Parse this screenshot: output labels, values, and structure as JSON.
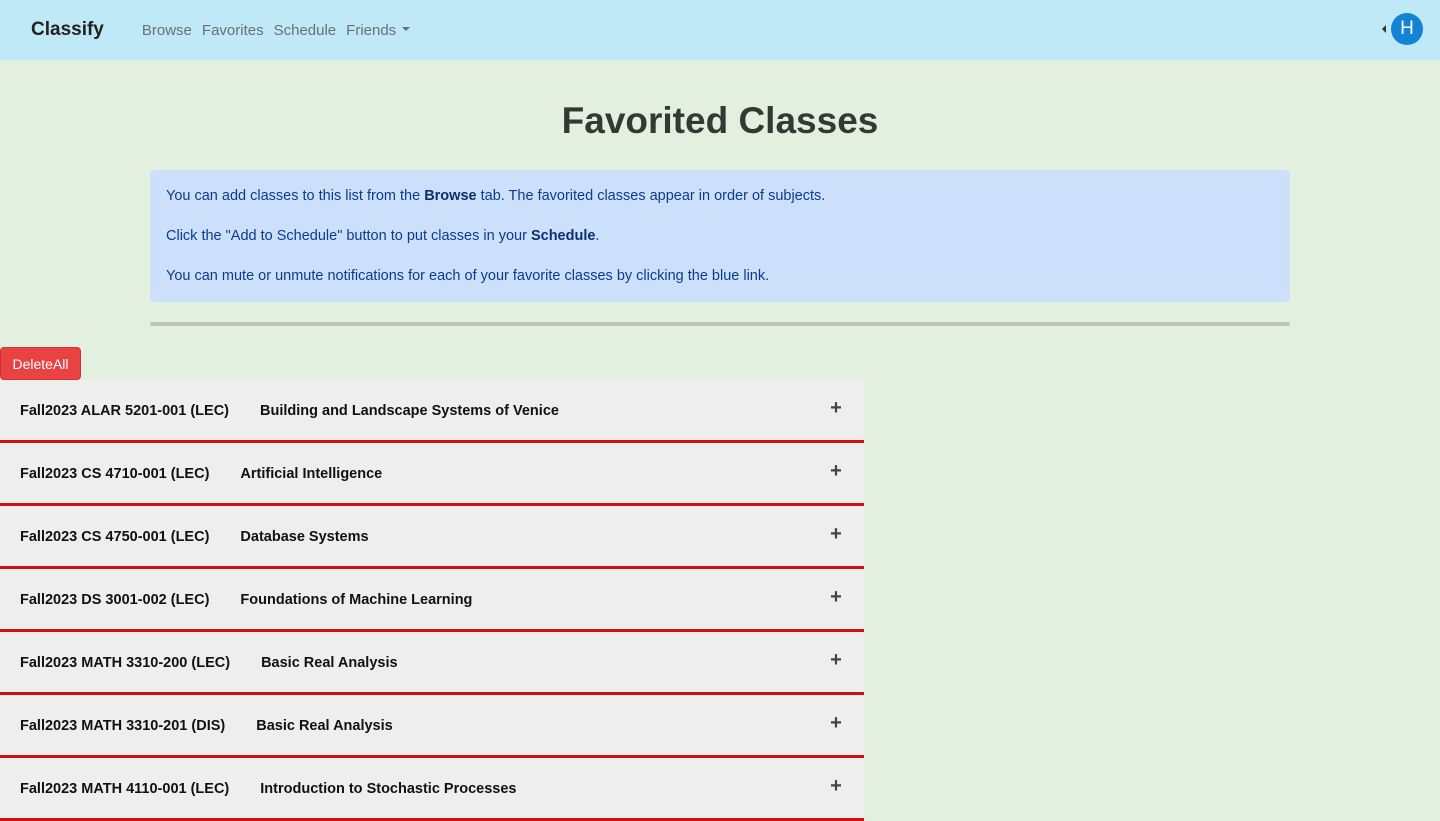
{
  "navbar": {
    "brand": "Classify",
    "links": [
      "Browse",
      "Favorites",
      "Schedule"
    ],
    "friends_label": "Friends",
    "avatar_initial": "H"
  },
  "page": {
    "title": "Favorited Classes"
  },
  "info": {
    "line1_pre": "You can add classes to this list from the ",
    "line1_bold": "Browse",
    "line1_post": " tab. The favorited classes appear in order of subjects.",
    "line2_pre": "Click the \"Add to Schedule\" button to put classes in your ",
    "line2_bold": "Schedule",
    "line2_post": ".",
    "line3": "You can mute or unmute notifications for each of your favorite classes by clicking the blue link."
  },
  "actions": {
    "delete_all_label": "DeleteAll"
  },
  "classes": [
    {
      "code": "Fall2023 ALAR 5201-001 (LEC)",
      "name": "Building and Landscape Systems of Venice"
    },
    {
      "code": "Fall2023 CS 4710-001 (LEC)",
      "name": "Artificial Intelligence"
    },
    {
      "code": "Fall2023 CS 4750-001 (LEC)",
      "name": "Database Systems"
    },
    {
      "code": "Fall2023 DS 3001-002 (LEC)",
      "name": "Foundations of Machine Learning"
    },
    {
      "code": "Fall2023 MATH 3310-200 (LEC)",
      "name": "Basic Real Analysis"
    },
    {
      "code": "Fall2023 MATH 3310-201 (DIS)",
      "name": "Basic Real Analysis"
    },
    {
      "code": "Fall2023 MATH 4110-001 (LEC)",
      "name": "Introduction to Stochastic Processes"
    }
  ],
  "icons": {
    "expand": "plus-icon"
  },
  "colors": {
    "navbar_bg": "#bfe9f6",
    "page_bg": "#e3efdf",
    "info_bg": "#cce0fc",
    "delete_btn": "#e94242",
    "row_separator": "#cc1111",
    "avatar_bg": "#1383d6"
  }
}
